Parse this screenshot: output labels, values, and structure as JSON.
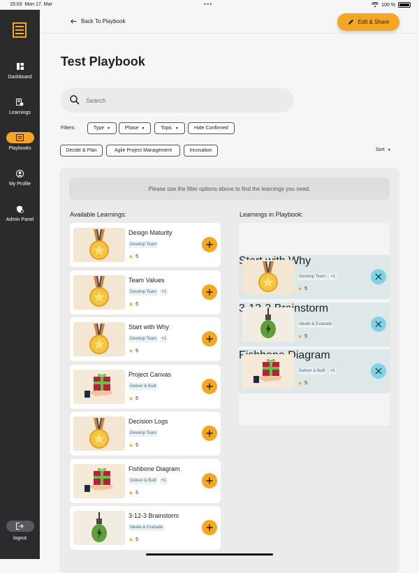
{
  "status": {
    "time": "15:03",
    "date": "Mon 17. Mar",
    "battery": "100 %"
  },
  "sidebar": {
    "items": [
      {
        "label": "Dashboard",
        "icon": "dashboard-icon"
      },
      {
        "label": "Learnings",
        "icon": "learnings-icon"
      },
      {
        "label": "Playbooks",
        "icon": "playbooks-icon",
        "active": true
      },
      {
        "label": "My Profile",
        "icon": "profile-icon"
      },
      {
        "label": "Admin Panel",
        "icon": "admin-shield-icon"
      }
    ],
    "logout": "logout"
  },
  "topbar": {
    "back": "Back To Playbook",
    "edit": "Edit & Share"
  },
  "page": {
    "title": "Test Playbook"
  },
  "search": {
    "placeholder": "Search"
  },
  "filters": {
    "label": "Filters:",
    "dropdowns": [
      "Type",
      "Phase",
      "Topic"
    ],
    "toggle": "Hide Confirmed",
    "active_chips": [
      "Decide & Plan",
      "Agile Project Management",
      "Innovation"
    ],
    "sort": "Sort"
  },
  "hint": "Please use the filter options above to find the learnings you need.",
  "available": {
    "title": "Available Learnings:",
    "cards": [
      {
        "title": "Design Maturity",
        "tag": "Develop Team",
        "more": "",
        "rating": "5",
        "thumb": "medal"
      },
      {
        "title": "Team Values",
        "tag": "Develop Team",
        "more": "+1",
        "rating": "5",
        "thumb": "medal"
      },
      {
        "title": "Start with Why",
        "tag": "Develop Team",
        "more": "+1",
        "rating": "5",
        "thumb": "medal"
      },
      {
        "title": "Project Canvas",
        "tag": "Deliver & Built",
        "more": "",
        "rating": "5",
        "thumb": "gift"
      },
      {
        "title": "Decision Logs",
        "tag": "Develop Team",
        "more": "",
        "rating": "5",
        "thumb": "medal"
      },
      {
        "title": "Fishbone Diagram",
        "tag": "Deliver & Built",
        "more": "+1",
        "rating": "5",
        "thumb": "gift"
      },
      {
        "title": "3-12-3 Brainstorm",
        "tag": "Ideate & Evaluate",
        "more": "",
        "rating": "5",
        "thumb": "bulb"
      }
    ]
  },
  "playbook": {
    "title": "Learnings in Playbook:",
    "cards": [
      {
        "title": "Start with Why",
        "tag": "Develop Team",
        "more": "+1",
        "rating": "5",
        "thumb": "medal"
      },
      {
        "title": "3-12-3 Brainstorm",
        "tag": "Ideate & Evaluate",
        "more": "",
        "rating": "5",
        "thumb": "bulb"
      },
      {
        "title": "Fishbone Diagram",
        "tag": "Deliver & Built",
        "more": "+1",
        "rating": "5",
        "thumb": "gift"
      }
    ]
  },
  "colors": {
    "accent": "#f5a623",
    "sidebar": "#2b2b2e",
    "remove": "#7fd3e6",
    "tag_text": "#2a7a9a"
  }
}
